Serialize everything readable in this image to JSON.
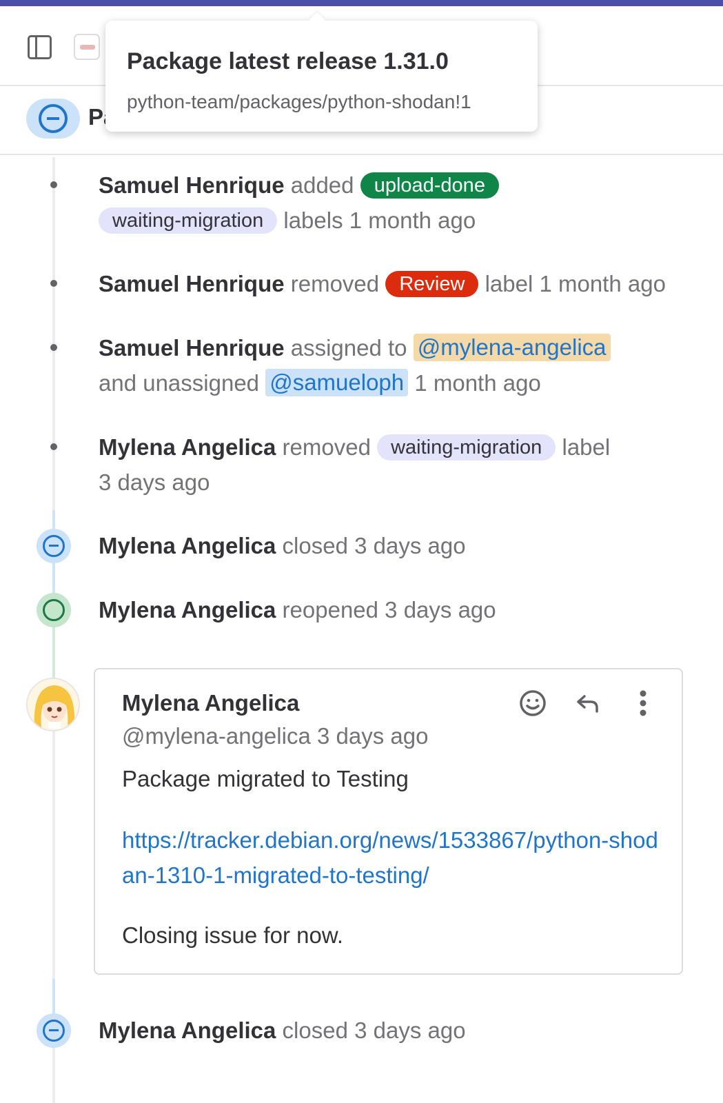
{
  "header": {
    "sidebar_toggle_icon": "sidebar-panel-icon",
    "project_avatar_icon": "project-avatar-icon"
  },
  "issue": {
    "status_icon": "issue-closed-icon",
    "title_visible": "Pa"
  },
  "tooltip": {
    "title": "Package latest release 1.31.0",
    "subtitle": "python-team/packages/python-shodan!1"
  },
  "events": [
    {
      "author": "Samuel Henrique",
      "action": "added",
      "labels": [
        "upload-done",
        "waiting-migration"
      ],
      "suffix": "labels 1 month ago"
    },
    {
      "author": "Samuel Henrique",
      "action": "removed",
      "label": "Review",
      "suffix": "label 1 month ago"
    },
    {
      "author": "Samuel Henrique",
      "action": "assigned to",
      "mention_assigned": "@mylena-angelica",
      "middle": "and unassigned",
      "mention_unassigned": "@samueloph",
      "suffix": "1 month ago"
    },
    {
      "author": "Mylena Angelica",
      "action": "removed",
      "label": "waiting-migration",
      "suffix": "label",
      "time": "3 days ago"
    },
    {
      "author": "Mylena Angelica",
      "action": "closed 3 days ago",
      "icon": "issue-closed-icon"
    },
    {
      "author": "Mylena Angelica",
      "action": "reopened 3 days ago",
      "icon": "issue-reopen-icon"
    }
  ],
  "note": {
    "author": "Mylena Angelica",
    "meta": "@mylena-angelica 3 days ago",
    "body": "Package migrated to Testing",
    "link": "https://tracker.debian.org/news/1533867/python-shodan-1310-1-migrated-to-testing/",
    "closing": "Closing issue for now.",
    "actions": [
      "emoji-reaction-icon",
      "reply-icon",
      "more-actions-icon"
    ]
  },
  "last_event": {
    "author": "Mylena Angelica",
    "action": "closed 3 days ago",
    "icon": "issue-closed-icon"
  },
  "colors": {
    "accent_bar": "#4b4fa8",
    "link_blue": "#1f75cb",
    "label_green": "#108548",
    "label_red": "#dd2b0e",
    "label_lavender": "#e3e4fb",
    "mention_orange": "#f5d9a8"
  }
}
